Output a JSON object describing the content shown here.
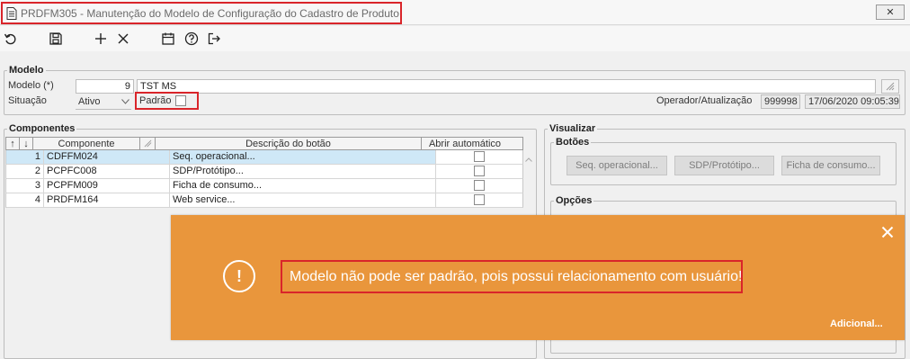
{
  "window": {
    "title": "PRDFM305 - Manutenção do Modelo de Configuração do Cadastro de Produto",
    "close_label": "✕"
  },
  "toolbar": {
    "icons": [
      "undo-icon",
      "save-icon",
      "add-icon",
      "delete-icon",
      "calendar-icon",
      "help-icon",
      "exit-icon"
    ]
  },
  "modelo": {
    "legend": "Modelo",
    "modelo_label": "Modelo (*)",
    "modelo_code": "9",
    "modelo_desc": "TST MS",
    "situacao_label": "Situação",
    "situacao_value": "Ativo",
    "padrao_label": "Padrão",
    "operador_label": "Operador/Atualização",
    "operador_value": "999998",
    "atualizacao_value": "17/06/2020 09:05:39"
  },
  "componentes": {
    "legend": "Componentes",
    "headers": [
      "↑",
      "↓",
      "Componente",
      "",
      "Descrição do botão",
      "Abrir automático"
    ],
    "rows": [
      {
        "seq": "1",
        "componente": "CDFFM024",
        "descricao": "Seq. operacional..."
      },
      {
        "seq": "2",
        "componente": "PCPFC008",
        "descricao": "SDP/Protótipo..."
      },
      {
        "seq": "3",
        "componente": "PCPFM009",
        "descricao": "Ficha de consumo..."
      },
      {
        "seq": "4",
        "componente": "PRDFM164",
        "descricao": "Web service..."
      }
    ]
  },
  "visualizar": {
    "legend": "Visualizar",
    "botoes_legend": "Botões",
    "botoes": [
      "Seq. operacional...",
      "SDP/Protótipo...",
      "Ficha de consumo..."
    ],
    "opcoes_legend": "Opções"
  },
  "toast": {
    "message": "Modelo não pode ser padrão, pois possui relacionamento com usuário!",
    "link": "Adicional...",
    "close": "✕",
    "info_symbol": "!"
  },
  "colors": {
    "toast_bg": "#e9963c",
    "highlight": "#d9252a",
    "selection": "#cfe8f7"
  }
}
